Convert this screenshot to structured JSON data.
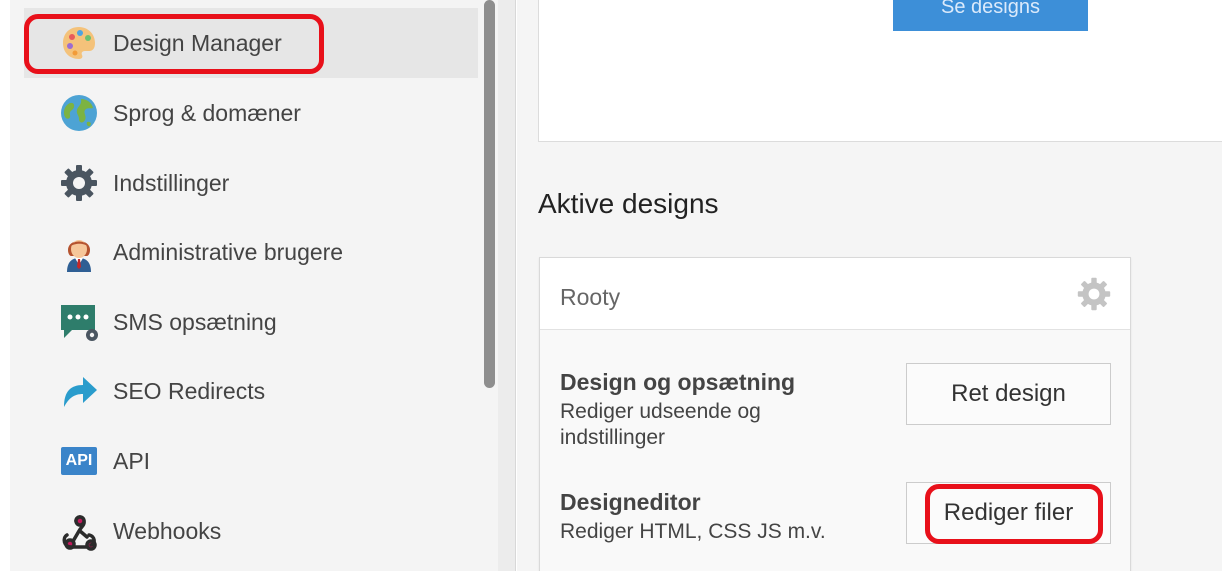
{
  "sidebar": {
    "items": [
      {
        "label": "Design Manager",
        "icon": "palette-icon",
        "active": true
      },
      {
        "label": "Sprog & domæner",
        "icon": "globe-icon"
      },
      {
        "label": "Indstillinger",
        "icon": "gear-icon"
      },
      {
        "label": "Administrative brugere",
        "icon": "admin-user-icon"
      },
      {
        "label": "SMS opsætning",
        "icon": "sms-icon"
      },
      {
        "label": "SEO Redirects",
        "icon": "redirect-arrow-icon"
      },
      {
        "label": "API",
        "icon": "api-icon",
        "icon_text": "API"
      },
      {
        "label": "Webhooks",
        "icon": "webhooks-icon"
      }
    ]
  },
  "top_panel": {
    "button_label": "Se designs"
  },
  "main": {
    "section_title": "Aktive designs",
    "card": {
      "title": "Rooty",
      "gear_icon": "gear-icon",
      "rows": [
        {
          "title": "Design og opsætning",
          "description": "Rediger udseende og indstillinger",
          "button": "Ret design"
        },
        {
          "title": "Designeditor",
          "description": "Rediger HTML, CSS JS m.v.",
          "button": "Rediger filer"
        }
      ]
    }
  },
  "colors": {
    "highlight": "#e8101a",
    "primary_button": "#3d8fd8"
  }
}
